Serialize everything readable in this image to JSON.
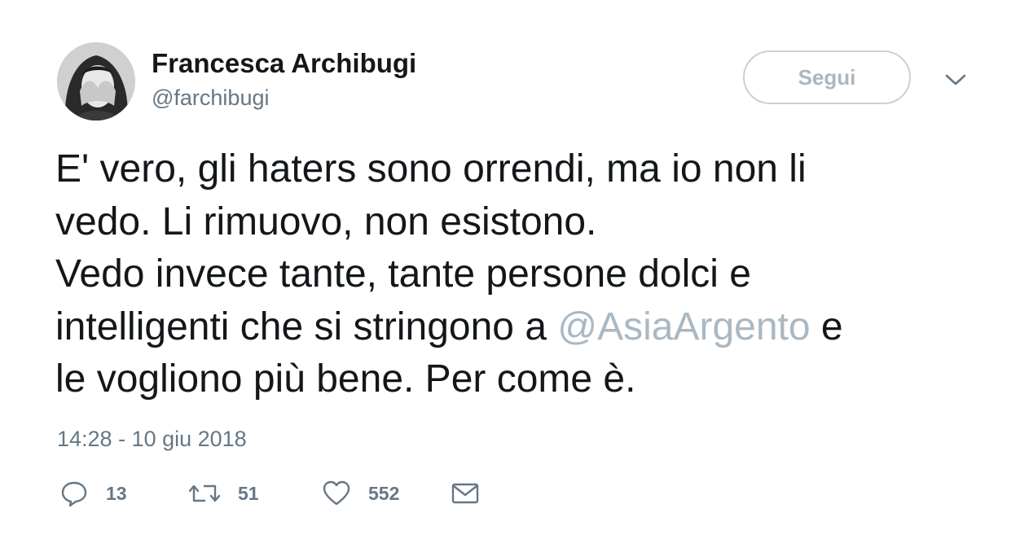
{
  "author": {
    "name": "Francesca Archibugi",
    "handle": "@farchibugi"
  },
  "follow_button": {
    "label": "Segui"
  },
  "tweet": {
    "lines": [
      "E' vero, gli haters sono orrendi, ma io non li",
      "vedo. Li rimuovo, non esistono.",
      "Vedo invece tante, tante persone dolci e",
      "intelligenti che si stringono a ",
      "le vogliono più bene. Per come è."
    ],
    "mention": "@AsiaArgento",
    "after_mention": " e"
  },
  "timestamp": "14:28 - 10 giu 2018",
  "actions": {
    "reply": {
      "icon": "reply-icon",
      "count": "13"
    },
    "retweet": {
      "icon": "retweet-icon",
      "count": "51"
    },
    "like": {
      "icon": "heart-icon",
      "count": "552"
    },
    "dm": {
      "icon": "envelope-icon"
    }
  },
  "colors": {
    "text": "#14171a",
    "secondary": "#657786",
    "mention": "#aab8c2",
    "button_border": "#c8d1d8"
  }
}
